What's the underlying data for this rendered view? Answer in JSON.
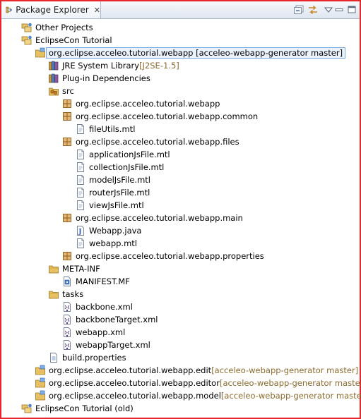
{
  "view": {
    "title": "Package Explorer",
    "close_glyph": "✕"
  },
  "tree": [
    {
      "label": "Other Projects",
      "icon": "working-set-icon"
    },
    {
      "label": "EclipseCon Tutorial",
      "icon": "working-set-icon"
    },
    {
      "label": "org.eclipse.acceleo.tutorial.webapp [acceleo-webapp-generator master]",
      "icon": "plugin-project-icon",
      "selected": true
    },
    {
      "label": "JRE System Library",
      "deco": " [J2SE-1.5]",
      "icon": "library-icon"
    },
    {
      "label": "Plug-in Dependencies",
      "icon": "library-icon"
    },
    {
      "label": "src",
      "icon": "source-folder-icon"
    },
    {
      "label": "org.eclipse.acceleo.tutorial.webapp",
      "icon": "package-icon"
    },
    {
      "label": "org.eclipse.acceleo.tutorial.webapp.common",
      "icon": "package-icon"
    },
    {
      "label": "fileUtils.mtl",
      "icon": "file-icon"
    },
    {
      "label": "org.eclipse.acceleo.tutorial.webapp.files",
      "icon": "package-icon"
    },
    {
      "label": "applicationJsFile.mtl",
      "icon": "file-icon"
    },
    {
      "label": "collectionJsFile.mtl",
      "icon": "file-icon"
    },
    {
      "label": "modelJsFile.mtl",
      "icon": "file-icon"
    },
    {
      "label": "routerJsFile.mtl",
      "icon": "file-icon"
    },
    {
      "label": "viewJsFile.mtl",
      "icon": "file-icon"
    },
    {
      "label": "org.eclipse.acceleo.tutorial.webapp.main",
      "icon": "package-icon"
    },
    {
      "label": "Webapp.java",
      "icon": "java-file-icon"
    },
    {
      "label": "webapp.mtl",
      "icon": "file-icon"
    },
    {
      "label": "org.eclipse.acceleo.tutorial.webapp.properties",
      "icon": "package-icon"
    },
    {
      "label": "META-INF",
      "icon": "folder-icon"
    },
    {
      "label": "MANIFEST.MF",
      "icon": "manifest-icon"
    },
    {
      "label": "tasks",
      "icon": "folder-icon"
    },
    {
      "label": "backbone.xml",
      "icon": "xml-file-icon"
    },
    {
      "label": "backboneTarget.xml",
      "icon": "xml-file-icon"
    },
    {
      "label": "webapp.xml",
      "icon": "xml-file-icon"
    },
    {
      "label": "webappTarget.xml",
      "icon": "xml-file-icon"
    },
    {
      "label": "build.properties",
      "icon": "properties-file-icon"
    },
    {
      "label": "org.eclipse.acceleo.tutorial.webapp.edit",
      "deco": " [acceleo-webapp-generator master]",
      "icon": "plugin-project-icon"
    },
    {
      "label": "org.eclipse.acceleo.tutorial.webapp.editor",
      "deco": " [acceleo-webapp-generator master]",
      "icon": "plugin-project-icon"
    },
    {
      "label": "org.eclipse.acceleo.tutorial.webapp.model",
      "deco": " [acceleo-webapp-generator master]",
      "icon": "plugin-project-icon"
    },
    {
      "label": "EclipseCon Tutorial (old)",
      "icon": "working-set-icon"
    }
  ],
  "colors": {
    "frame_border": "#e8262e",
    "decoration_text": "#8b6b2e",
    "selection_border": "#7aa7e0"
  }
}
